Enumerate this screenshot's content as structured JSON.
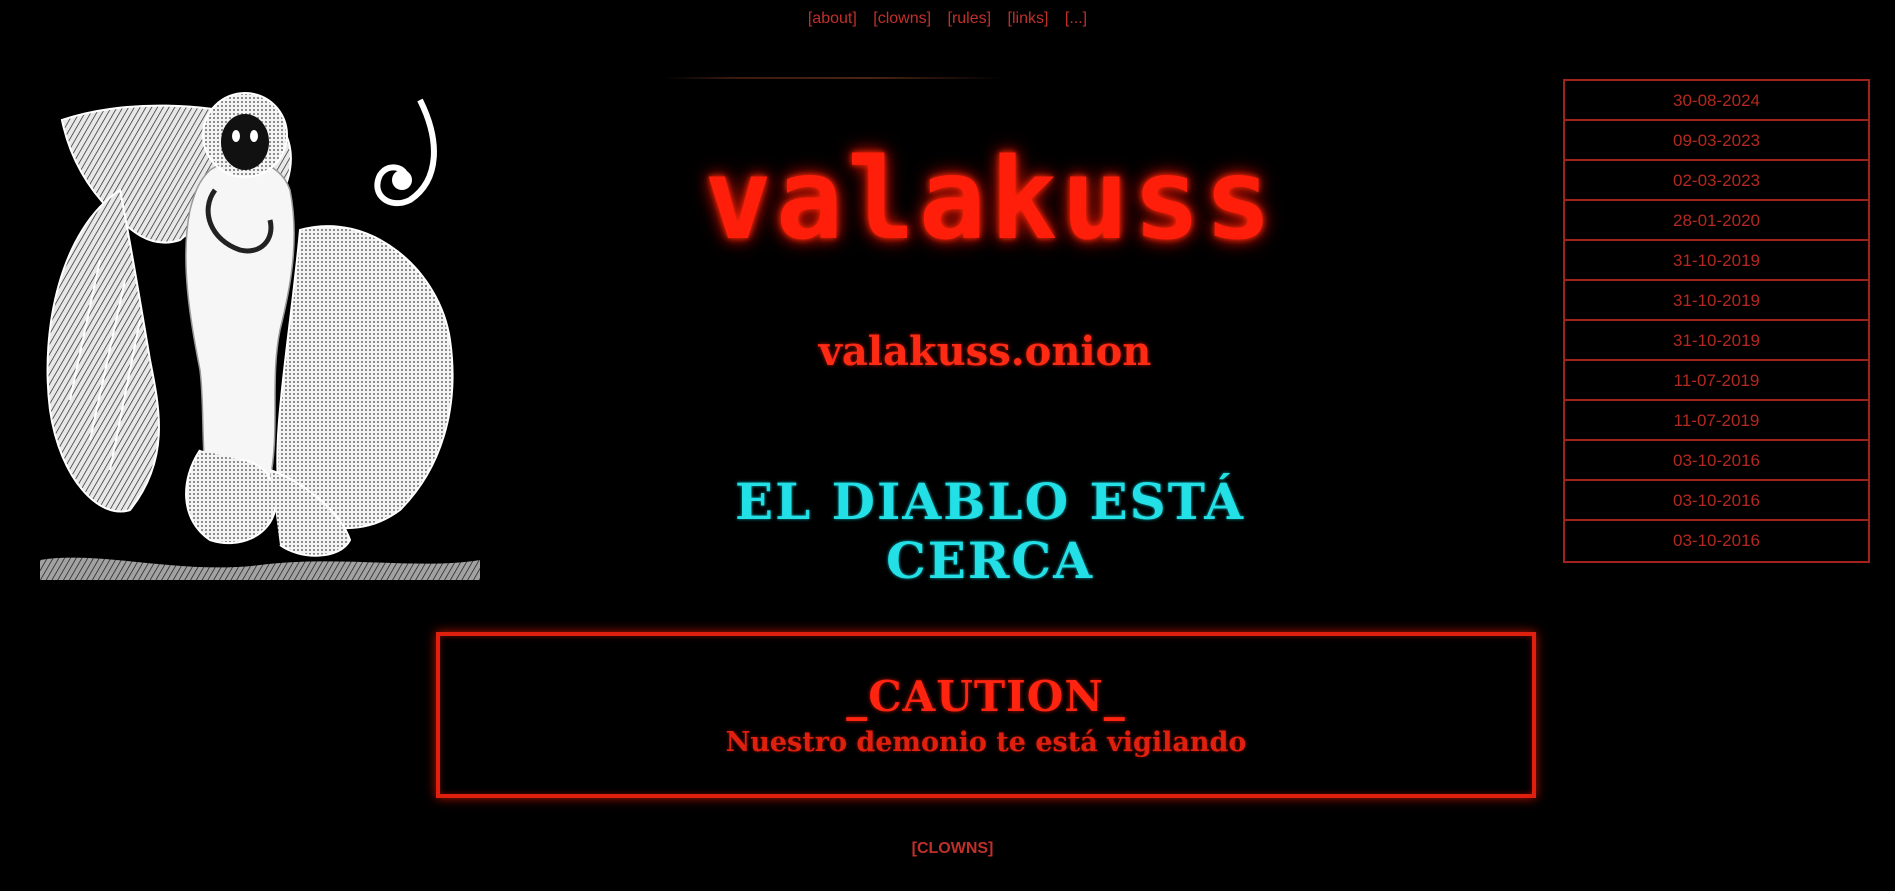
{
  "nav": {
    "items": [
      {
        "label": "[about]"
      },
      {
        "label": "[clowns]"
      },
      {
        "label": "[rules]"
      },
      {
        "label": "[links]"
      },
      {
        "label": "[...]"
      }
    ]
  },
  "logo": {
    "word": "valakuss",
    "domain": "valakuss.onion",
    "slogan": "EL DIABLO ESTÁ CERCA"
  },
  "dates": [
    "30-08-2024",
    "09-03-2023",
    "02-03-2023",
    "28-01-2020",
    "31-10-2019",
    "31-10-2019",
    "31-10-2019",
    "11-07-2019",
    "11-07-2019",
    "03-10-2016",
    "03-10-2016",
    "03-10-2016"
  ],
  "caution": {
    "title": "_CAUTION_",
    "subtitle": "Nuestro demonio te está vigilando"
  },
  "footer": {
    "link_label": "[CLOWNS]"
  },
  "colors": {
    "background": "#000000",
    "accent_red": "#e0200e",
    "link_red": "#c0302a",
    "slogan_cyan": "#22e0e6"
  },
  "icons": {
    "illustration": "winged-demon-illustration"
  }
}
